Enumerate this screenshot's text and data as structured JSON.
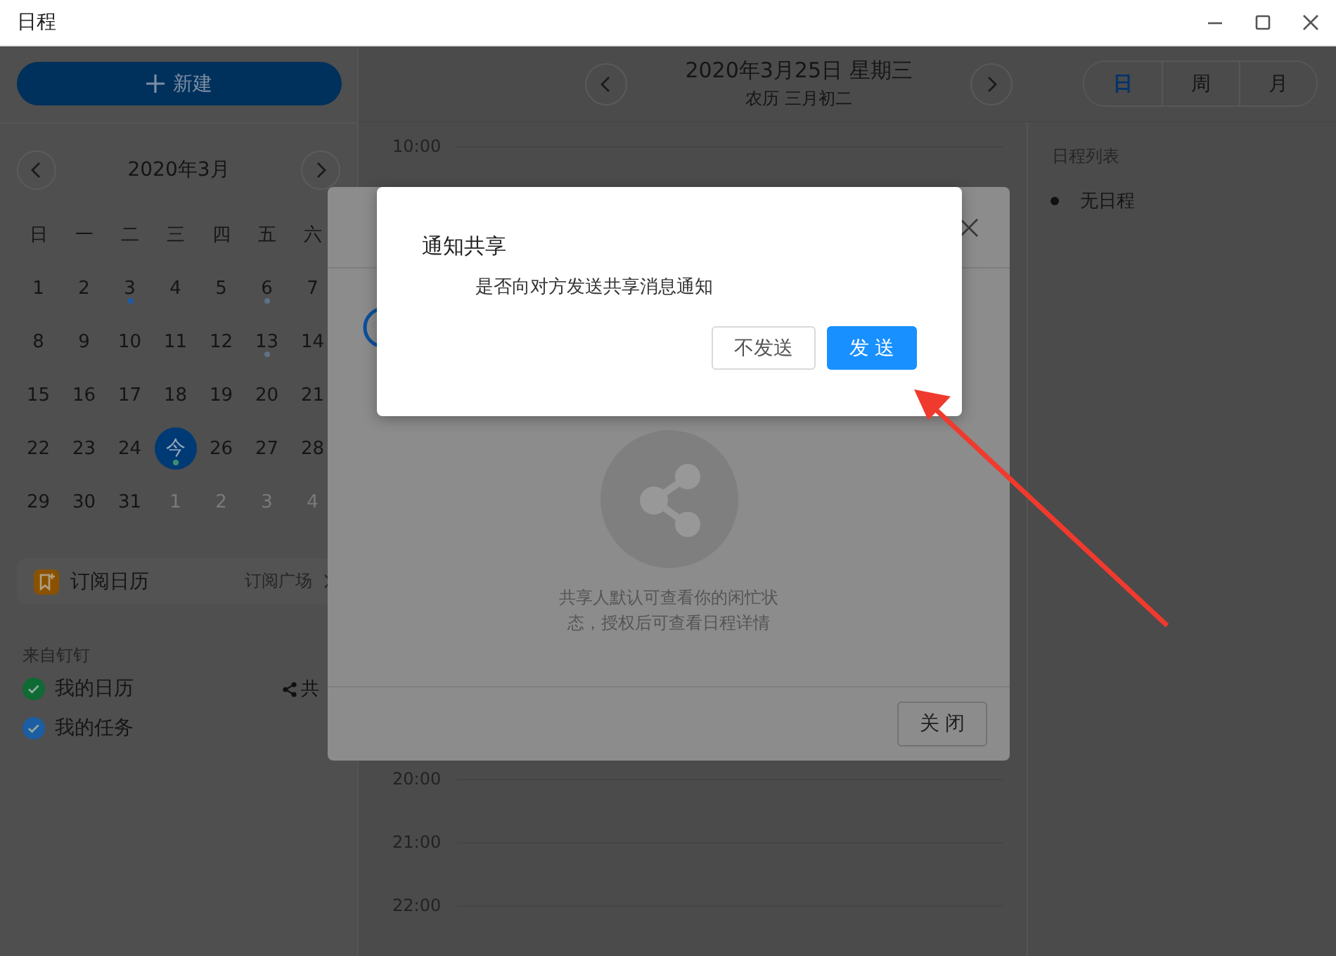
{
  "window": {
    "title": "日程"
  },
  "sidebar": {
    "new_button": "新建",
    "month_title": "2020年3月",
    "weekdays": [
      "日",
      "一",
      "二",
      "三",
      "四",
      "五",
      "六"
    ],
    "weeks": [
      [
        {
          "day": "1",
          "today": false,
          "muted": false
        },
        {
          "day": "2",
          "today": false,
          "muted": false
        },
        {
          "day": "3",
          "today": false,
          "muted": false,
          "color": "#1d5aa8"
        },
        {
          "day": "4",
          "today": false,
          "muted": false
        },
        {
          "day": "5",
          "today": false,
          "muted": false
        },
        {
          "day": "6",
          "today": false,
          "muted": false,
          "color": "#5f7185"
        },
        {
          "day": "7",
          "today": false,
          "muted": false
        }
      ],
      [
        {
          "day": "8",
          "today": false,
          "muted": false
        },
        {
          "day": "9",
          "today": false,
          "muted": false
        },
        {
          "day": "10",
          "today": false,
          "muted": false
        },
        {
          "day": "11",
          "today": false,
          "muted": false
        },
        {
          "day": "12",
          "today": false,
          "muted": false
        },
        {
          "day": "13",
          "today": false,
          "muted": false,
          "color": "#5f7185"
        },
        {
          "day": "14",
          "today": false,
          "muted": false
        }
      ],
      [
        {
          "day": "15",
          "today": false,
          "muted": false
        },
        {
          "day": "16",
          "today": false,
          "muted": false
        },
        {
          "day": "17",
          "today": false,
          "muted": false
        },
        {
          "day": "18",
          "today": false,
          "muted": false
        },
        {
          "day": "19",
          "today": false,
          "muted": false
        },
        {
          "day": "20",
          "today": false,
          "muted": false
        },
        {
          "day": "21",
          "today": false,
          "muted": false
        }
      ],
      [
        {
          "day": "22",
          "today": false,
          "muted": false
        },
        {
          "day": "23",
          "today": false,
          "muted": false
        },
        {
          "day": "24",
          "today": false,
          "muted": false
        },
        {
          "day": "今",
          "today": true,
          "muted": false,
          "color": "#3f8f6f"
        },
        {
          "day": "26",
          "today": false,
          "muted": false
        },
        {
          "day": "27",
          "today": false,
          "muted": false
        },
        {
          "day": "28",
          "today": false,
          "muted": false
        }
      ],
      [
        {
          "day": "29",
          "today": false,
          "muted": false
        },
        {
          "day": "30",
          "today": false,
          "muted": false
        },
        {
          "day": "31",
          "today": false,
          "muted": false
        },
        {
          "day": "1",
          "today": false,
          "muted": true
        },
        {
          "day": "2",
          "today": false,
          "muted": true
        },
        {
          "day": "3",
          "today": false,
          "muted": true
        },
        {
          "day": "4",
          "today": false,
          "muted": true
        }
      ]
    ],
    "subscribe": {
      "label": "订阅日历",
      "link": "订阅广场"
    },
    "calendars": {
      "heading": "来自钉钉",
      "items": [
        {
          "label": "我的日历",
          "checked": true,
          "color": "#0e6b34",
          "action": "共"
        },
        {
          "label": "我的任务",
          "checked": true,
          "color": "#1c5ea3"
        }
      ]
    }
  },
  "header": {
    "date": "2020年3月25日 星期三",
    "lunar": "农历 三月初二",
    "view_tabs": [
      {
        "label": "日",
        "selected": true
      },
      {
        "label": "周",
        "selected": false
      },
      {
        "label": "月",
        "selected": false
      }
    ]
  },
  "timeline": [
    "10:00",
    "20:00",
    "21:00",
    "22:00"
  ],
  "agenda": {
    "heading": "日程列表",
    "items": [
      "无日程"
    ]
  },
  "share_dialog": {
    "hint": "共享人默认可查看你的闲忙状态，授权后可查看日程详情",
    "close_button": "关 闭"
  },
  "notify_dialog": {
    "title": "通知共享",
    "message": "是否向对方发送共享消息通知",
    "buttons": [
      {
        "label": "不发送",
        "kind": "secondary"
      },
      {
        "label": "发 送",
        "kind": "primary"
      }
    ]
  }
}
